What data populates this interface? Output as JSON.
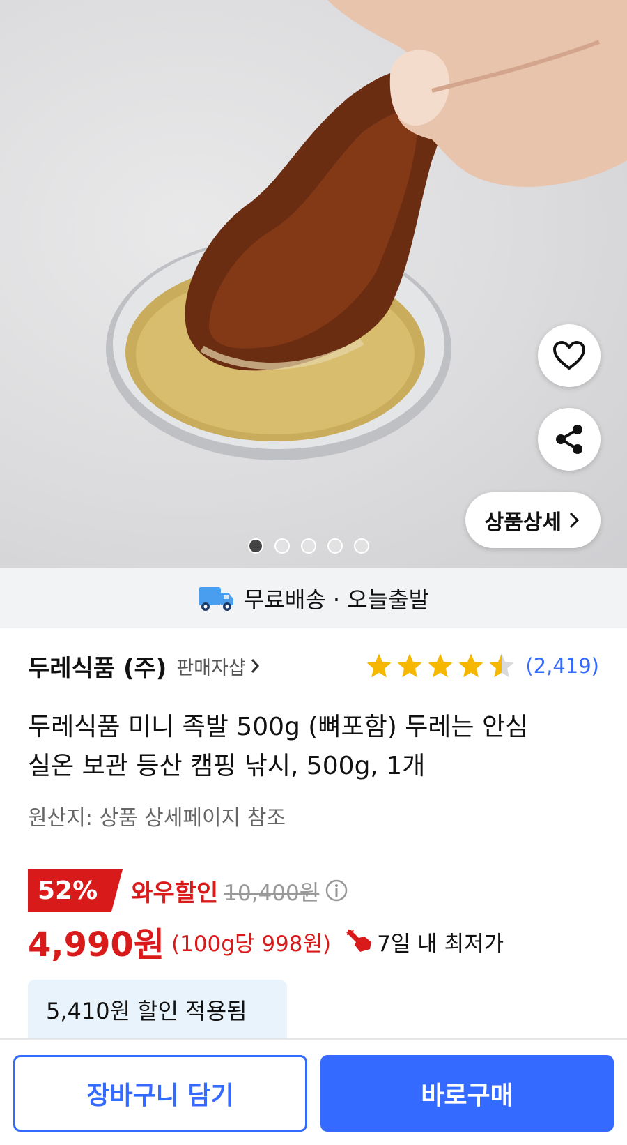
{
  "hero": {
    "image_alt": "product-photo-jokbal-dipped-in-sauce",
    "detail_label": "상품상세",
    "carousel": {
      "total": 5,
      "active_index": 0
    }
  },
  "delivery": {
    "text": "무료배송 · 오늘출발"
  },
  "seller": {
    "name": "두레식품 (주)",
    "shop_link": "판매자샵"
  },
  "rating": {
    "stars": 4.5,
    "review_count": "(2,419)"
  },
  "product": {
    "title_line1": "두레식품 미니 족발 500g (뼈포함) 두레는 안심",
    "title_line2": "실온 보관 등산 캠핑 낚시, 500g, 1개",
    "origin": "원산지: 상품 상세페이지 참조"
  },
  "price": {
    "discount_rate": "52%",
    "wow_label": "와우할인",
    "original": "10,400원",
    "final": "4,990원",
    "unit": "(100g당 998원)",
    "lowest_label": "7일 내 최저가",
    "applied_discount": "5,410원 할인 적용됨"
  },
  "actions": {
    "cart_label": "장바구니 담기",
    "buy_label": "바로구매"
  },
  "colors": {
    "accent_blue": "#346aff",
    "sale_red": "#d91a1a",
    "star_yellow": "#f5b700"
  }
}
